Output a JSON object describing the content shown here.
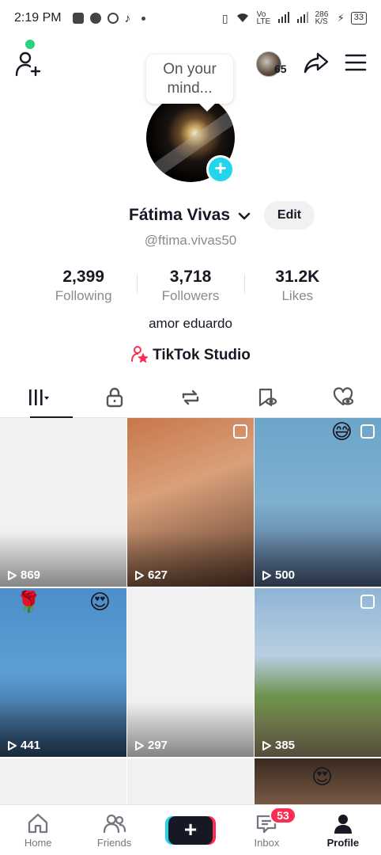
{
  "status_bar": {
    "time": "2:19 PM",
    "network_speed": "286 K/S",
    "network_type": "Vo LTE",
    "battery": "33"
  },
  "header": {
    "mind_bubble": "On your mind...",
    "mini_avatar_count": "65"
  },
  "profile": {
    "display_name": "Fátima Vivas",
    "edit_label": "Edit",
    "username": "@ftima.vivas50",
    "bio": "amor eduardo",
    "studio_label": "TikTok Studio"
  },
  "stats": [
    {
      "value": "2,399",
      "label": "Following"
    },
    {
      "value": "3,718",
      "label": "Followers"
    },
    {
      "value": "31.2K",
      "label": "Likes"
    }
  ],
  "tabs": [
    "videos-tab",
    "private-tab",
    "reposts-tab",
    "saved-tab",
    "liked-tab"
  ],
  "videos": [
    {
      "views": "869"
    },
    {
      "views": "627"
    },
    {
      "views": "500"
    },
    {
      "views": "441"
    },
    {
      "views": "297"
    },
    {
      "views": "385"
    }
  ],
  "bottom_nav": {
    "home": "Home",
    "friends": "Friends",
    "create": "+",
    "inbox": "Inbox",
    "inbox_badge": "53",
    "profile": "Profile"
  },
  "colors": {
    "accent_cyan": "#20d5ec",
    "accent_red": "#fe2c55",
    "online_green": "#2ad27f",
    "text_primary": "#161823",
    "text_secondary": "#8a8b91"
  }
}
